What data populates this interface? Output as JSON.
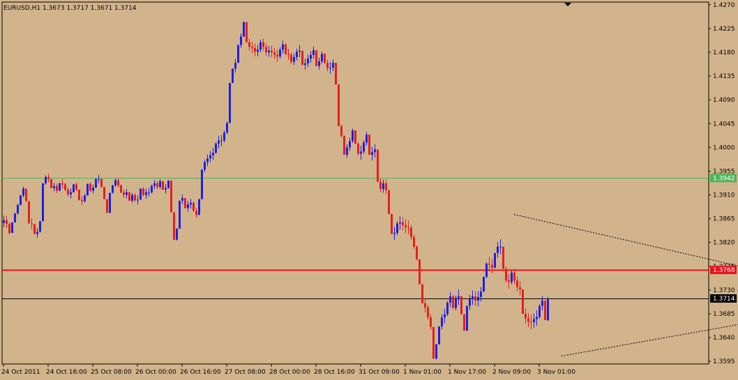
{
  "window": {
    "info_line": "EURUSD,H1  1.3673 1.3717 1.3671 1.3714"
  },
  "colors": {
    "background": "#d2b48c",
    "frame": "#000000",
    "bull_candle": "#1e1ee6",
    "bear_candle": "#e61e1e",
    "resistance_line": "#4cb45a",
    "support_line": "#e6141e",
    "current_price_line": "#000000",
    "text": "#000000"
  },
  "chart_data": {
    "type": "candlestick",
    "symbol": "EURUSD",
    "timeframe": "H1",
    "ohlc_last": {
      "open": 1.3673,
      "high": 1.3717,
      "low": 1.3671,
      "close": 1.3714
    },
    "ylim": [
      1.359,
      1.4275
    ],
    "y_ticks": [
      "1.4270",
      "1.4225",
      "1.4180",
      "1.4135",
      "1.4090",
      "1.4045",
      "1.4000",
      "1.3955",
      "1.3910",
      "1.3865",
      "1.3820",
      "1.3775",
      "1.3730",
      "1.3685",
      "1.3640",
      "1.3595"
    ],
    "x_ticks": [
      "24 Oct 2011",
      "24 Oct 16:00",
      "25 Oct 08:00",
      "26 Oct 00:00",
      "26 Oct 16:00",
      "27 Oct 08:00",
      "28 Oct 00:00",
      "28 Oct 16:00",
      "31 Oct 09:00",
      "1 Nov 01:00",
      "1 Nov 17:00",
      "2 Nov 09:00",
      "3 Nov 01:00"
    ],
    "horizontal_lines": [
      {
        "name": "resistance",
        "price": 1.3942,
        "label": "1.3942",
        "color": "#4cb45a"
      },
      {
        "name": "support",
        "price": 1.3768,
        "label": "1.3768",
        "color": "#e6141e"
      },
      {
        "name": "current",
        "price": 1.3714,
        "label": "1.3714",
        "color": "#000000"
      }
    ],
    "trendlines": [
      {
        "name": "upper-trendline",
        "from": {
          "bar": 183,
          "price": 1.3873
        },
        "to": {
          "bar": 315,
          "price": 1.3713
        }
      },
      {
        "name": "lower-trendline",
        "from": {
          "bar": 200,
          "price": 1.3605
        },
        "to": {
          "bar": 315,
          "price": 1.3713
        }
      }
    ],
    "closes": [
      1.3862,
      1.3855,
      1.3838,
      1.3858,
      1.3875,
      1.3891,
      1.3909,
      1.3922,
      1.3898,
      1.3856,
      1.3855,
      1.3836,
      1.384,
      1.386,
      1.3932,
      1.3944,
      1.394,
      1.3923,
      1.3927,
      1.3918,
      1.3932,
      1.393,
      1.392,
      1.3911,
      1.3915,
      1.393,
      1.392,
      1.39,
      1.3898,
      1.3909,
      1.3931,
      1.3918,
      1.3924,
      1.394,
      1.394,
      1.3925,
      1.3902,
      1.3876,
      1.3914,
      1.3928,
      1.3938,
      1.3928,
      1.3915,
      1.391,
      1.3915,
      1.3899,
      1.391,
      1.39,
      1.3901,
      1.3922,
      1.391,
      1.3915,
      1.3915,
      1.3927,
      1.3932,
      1.3925,
      1.3936,
      1.392,
      1.3923,
      1.3937,
      1.3877,
      1.3825,
      1.3846,
      1.3899,
      1.3904,
      1.3885,
      1.3892,
      1.3895,
      1.388,
      1.3872,
      1.3902,
      1.3958,
      1.3972,
      1.3979,
      1.3985,
      1.399,
      1.4007,
      1.4013,
      1.4013,
      1.4028,
      1.4046,
      1.4122,
      1.4149,
      1.416,
      1.4194,
      1.421,
      1.4237,
      1.4199,
      1.419,
      1.4188,
      1.4181,
      1.4185,
      1.4199,
      1.419,
      1.418,
      1.4183,
      1.418,
      1.4175,
      1.4172,
      1.4185,
      1.4195,
      1.4177,
      1.4175,
      1.4162,
      1.4171,
      1.4181,
      1.4183,
      1.4156,
      1.4159,
      1.4168,
      1.4175,
      1.4184,
      1.4154,
      1.4163,
      1.4177,
      1.416,
      1.415,
      1.4151,
      1.416,
      1.4119,
      1.404,
      1.4022,
      1.3986,
      1.4,
      1.4012,
      1.4032,
      1.4007,
      1.3988,
      1.3992,
      1.4009,
      1.4024,
      1.3986,
      1.3991,
      1.3996,
      1.3935,
      1.3921,
      1.3932,
      1.3919,
      1.3874,
      1.3836,
      1.3838,
      1.3856,
      1.3858,
      1.3853,
      1.3849,
      1.3848,
      1.383,
      1.3812,
      1.3788,
      1.3741,
      1.3705,
      1.3697,
      1.3678,
      1.366,
      1.36,
      1.3627,
      1.3661,
      1.3678,
      1.3684,
      1.3706,
      1.3718,
      1.3696,
      1.3715,
      1.3718,
      1.3684,
      1.3653,
      1.37,
      1.3713,
      1.3718,
      1.371,
      1.3717,
      1.3727,
      1.3755,
      1.378,
      1.3778,
      1.3772,
      1.38,
      1.3812,
      1.3812,
      1.377,
      1.3748,
      1.3745,
      1.3763,
      1.3748,
      1.3735,
      1.3731,
      1.3685,
      1.3676,
      1.367,
      1.3669,
      1.3675,
      1.3679,
      1.37,
      1.371,
      1.3673,
      1.3714
    ],
    "ranges": [
      0.0022,
      0.0023,
      0.0022,
      0.002,
      0.0018,
      0.002,
      0.0019,
      0.002,
      0.0022,
      0.002,
      0.0021,
      0.0017,
      0.0018,
      0.0022,
      0.0016,
      0.0018,
      0.0016,
      0.0017,
      0.0016,
      0.0018,
      0.0016,
      0.0018,
      0.0016,
      0.0017,
      0.0019,
      0.0016,
      0.0016,
      0.0017,
      0.0016,
      0.0017,
      0.0016,
      0.0018,
      0.0017,
      0.0019,
      0.0016,
      0.0018,
      0.0016,
      0.0017,
      0.0018,
      0.0016,
      0.0016,
      0.0018,
      0.0017,
      0.0016,
      0.0018,
      0.0017,
      0.0018,
      0.0016,
      0.0017,
      0.0016,
      0.0017,
      0.0019,
      0.0016,
      0.0017,
      0.0017,
      0.0016,
      0.0018,
      0.0017,
      0.0018,
      0.0016,
      0.0025,
      0.0022,
      0.0023,
      0.002,
      0.0018,
      0.0019,
      0.002,
      0.0018,
      0.002,
      0.0019,
      0.0022,
      0.0023,
      0.0024,
      0.0022,
      0.0021,
      0.0023,
      0.0022,
      0.0024,
      0.0021,
      0.0022,
      0.0024,
      0.0026,
      0.0028,
      0.0026,
      0.0028,
      0.0027,
      0.0029,
      0.0028,
      0.0023,
      0.0022,
      0.0024,
      0.0022,
      0.0024,
      0.0022,
      0.0023,
      0.0021,
      0.0022,
      0.0021,
      0.0023,
      0.0022,
      0.0024,
      0.0022,
      0.0021,
      0.0023,
      0.0022,
      0.0022,
      0.0023,
      0.0022,
      0.0021,
      0.0023,
      0.0022,
      0.0023,
      0.0022,
      0.0022,
      0.0023,
      0.0021,
      0.0022,
      0.0023,
      0.0022,
      0.0026,
      0.0027,
      0.0025,
      0.0027,
      0.0026,
      0.0025,
      0.0027,
      0.0026,
      0.0025,
      0.0027,
      0.0026,
      0.0025,
      0.0027,
      0.0026,
      0.0025,
      0.0027,
      0.0026,
      0.0025,
      0.0027,
      0.0028,
      0.0026,
      0.0025,
      0.0027,
      0.0026,
      0.0025,
      0.0027,
      0.0026,
      0.0028,
      0.0027,
      0.0028,
      0.0029,
      0.003,
      0.0027,
      0.0028,
      0.0029,
      0.003,
      0.0029,
      0.0028,
      0.0029,
      0.0027,
      0.0028,
      0.0029,
      0.0027,
      0.0028,
      0.0029,
      0.0027,
      0.0028,
      0.003,
      0.0029,
      0.0027,
      0.0028,
      0.0029,
      0.0027,
      0.0029,
      0.003,
      0.0028,
      0.0027,
      0.0029,
      0.003,
      0.0028,
      0.0029,
      0.003,
      0.0028,
      0.0027,
      0.0029,
      0.0028,
      0.0027,
      0.0029,
      0.0028,
      0.0027,
      0.0028,
      0.0027,
      0.0029,
      0.0028,
      0.0027,
      0.0029,
      0.003,
      0.0046
    ]
  }
}
